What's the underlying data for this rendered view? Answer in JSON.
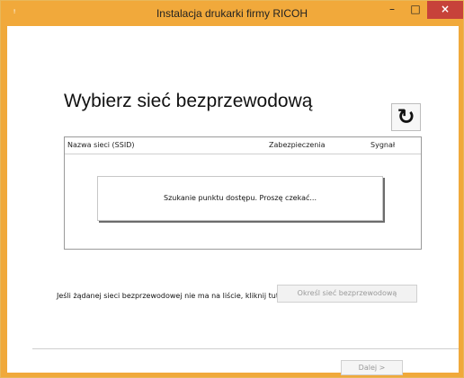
{
  "window": {
    "title": "Instalacja drukarki firmy RICOH",
    "controls": {
      "minimize": "–",
      "maximize": "□",
      "close": "×"
    }
  },
  "main": {
    "heading": "Wybierz sieć bezprzewodową",
    "refresh_icon": "refresh-icon",
    "table": {
      "columns": [
        "Nazwa sieci (SSID)",
        "Zabezpieczenia",
        "Sygnał"
      ],
      "searching_message": "Szukanie punktu dostępu. Proszę czekać..."
    },
    "info_text": "Jeśli żądanej sieci bezprzewodowej nie ma na liście, kliknij tutaj.",
    "define_network_button": "Określ sieć bezprzewodową",
    "next_button": "Dalej >"
  },
  "colors": {
    "title_bar": "#f1a93b",
    "close_button": "#c7423a",
    "disabled_text": "#9a9a9a"
  }
}
